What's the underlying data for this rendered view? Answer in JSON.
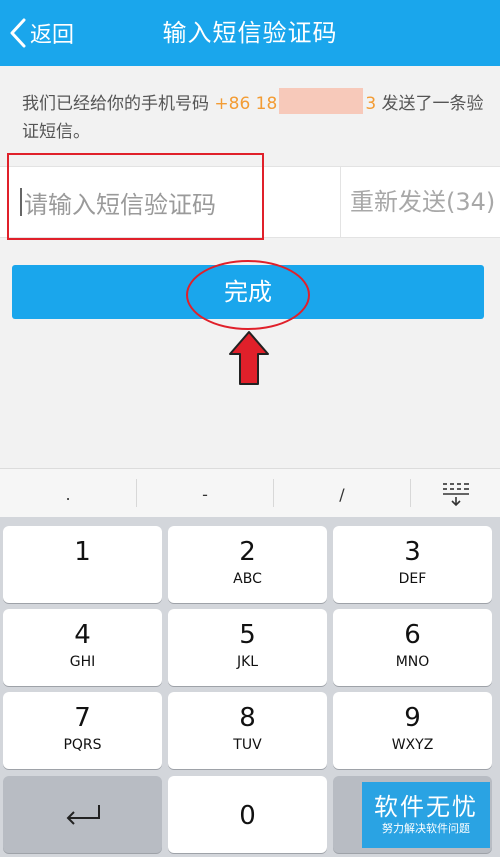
{
  "header": {
    "back_label": "返回",
    "title": "输入短信验证码"
  },
  "notice": {
    "prefix": "我们已经给你的手机号码 ",
    "phone_start": "+86 18",
    "phone_end": "3",
    "suffix": " 发送了一条验证短信。"
  },
  "code_input": {
    "placeholder": "请输入短信验证码",
    "value": ""
  },
  "resend": {
    "label": "重新发送(34)"
  },
  "done_button": {
    "label": "完成"
  },
  "keyboard": {
    "symbols": [
      ".",
      "-",
      "/"
    ],
    "keys": [
      {
        "digit": "1",
        "letters": ""
      },
      {
        "digit": "2",
        "letters": "ABC"
      },
      {
        "digit": "3",
        "letters": "DEF"
      },
      {
        "digit": "4",
        "letters": "GHI"
      },
      {
        "digit": "5",
        "letters": "JKL"
      },
      {
        "digit": "6",
        "letters": "MNO"
      },
      {
        "digit": "7",
        "letters": "PQRS"
      },
      {
        "digit": "8",
        "letters": "TUV"
      },
      {
        "digit": "9",
        "letters": "WXYZ"
      }
    ],
    "zero": "0"
  },
  "watermark": {
    "title": "软件无忧",
    "subtitle": "努力解决软件问题"
  },
  "colors": {
    "brand": "#1aa6ec",
    "highlight": "#e0202a",
    "phone": "#f39c34"
  }
}
